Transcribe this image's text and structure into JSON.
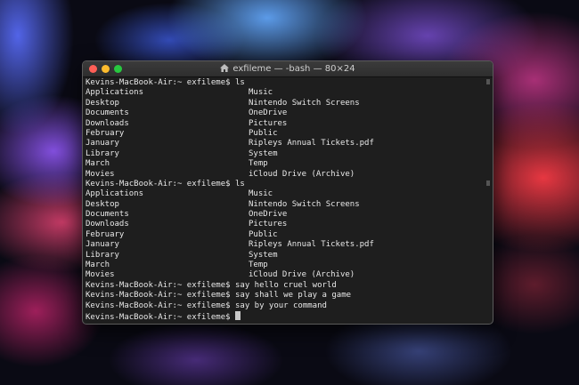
{
  "window": {
    "title": "exfileme — -bash — 80×24"
  },
  "terminal": {
    "prompt": "Kevins-MacBook-Air:~ exfileme$",
    "ls_command": "ls",
    "listing": [
      [
        "Applications",
        "Music"
      ],
      [
        "Desktop",
        "Nintendo Switch Screens"
      ],
      [
        "Documents",
        "OneDrive"
      ],
      [
        "Downloads",
        "Pictures"
      ],
      [
        "February",
        "Public"
      ],
      [
        "January",
        "Ripleys Annual Tickets.pdf"
      ],
      [
        "Library",
        "System"
      ],
      [
        "March",
        "Temp"
      ],
      [
        "Movies",
        "iCloud Drive (Archive)"
      ]
    ],
    "say_commands": [
      "say hello cruel world",
      "say shall we play a game",
      "say by your command"
    ]
  },
  "icons": {
    "title_icon": "home-folder-icon"
  },
  "colors": {
    "terminal_bg": "#1e1e1e",
    "text": "#e8e8e8",
    "close": "#ff5f57",
    "minimize": "#febc2e",
    "zoom": "#28c840"
  }
}
